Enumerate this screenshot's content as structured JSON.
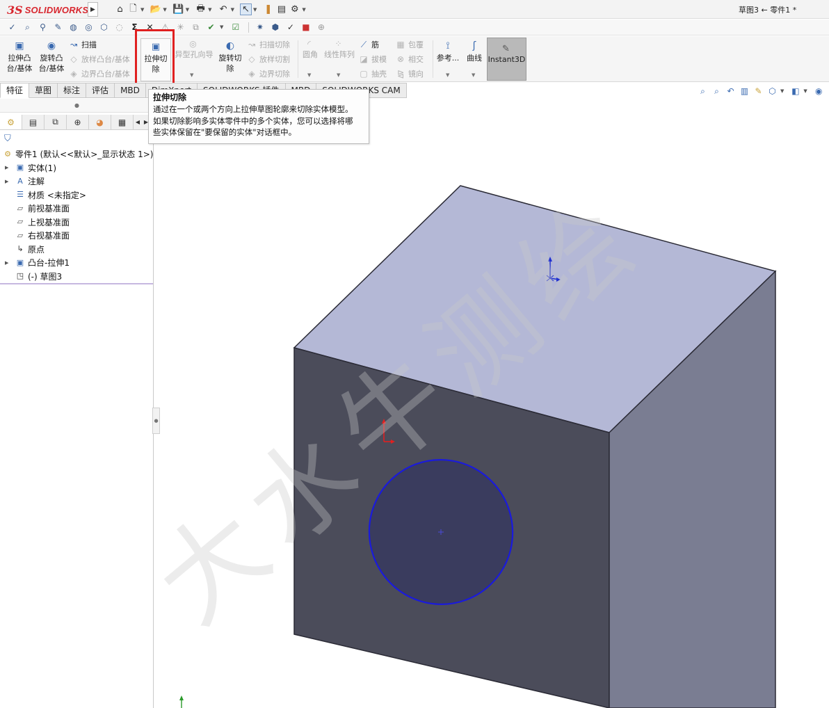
{
  "window": {
    "brand_ds": "3S",
    "brand_name": "SOLIDWORKS",
    "doc_title": "草图3 ← 零件1 *"
  },
  "quick_access": {
    "icons": [
      "home-icon",
      "new-doc-icon",
      "open-icon",
      "save-icon",
      "print-icon",
      "undo-icon",
      "select-pointer-icon",
      "rebuild-icon",
      "file-properties-icon",
      "options-gear-icon"
    ]
  },
  "ribbon": {
    "extrude_boss": "拉伸凸台/基体",
    "revolve_boss": "旋转凸台/基体",
    "sweep": "扫描",
    "loft_boss": "放样凸台/基体",
    "boundary_boss": "边界凸台/基体",
    "extrude_cut": "拉伸切除",
    "hole_wizard": "异型孔向导",
    "revolve_cut": "旋转切除",
    "swept_cut": "扫描切除",
    "lofted_cut": "放样切割",
    "boundary_cut": "边界切除",
    "fillet": "圆角",
    "linear_pattern": "线性阵列",
    "rib": "筋",
    "draft": "拔模",
    "shell": "抽壳",
    "wrap": "包覆",
    "intersect": "相交",
    "mirror": "镜向",
    "reference": "参考...",
    "curves": "曲线",
    "instant3d": "Instant3D"
  },
  "tabs": [
    "特征",
    "草图",
    "标注",
    "评估",
    "MBD",
    "DimXpert",
    "SOLIDWORKS 插件",
    "MBD",
    "SOLIDWORKS CAM"
  ],
  "tooltip": {
    "title": "拉伸切除",
    "line1": "通过在一个或两个方向上拉伸草图轮廓来切除实体模型。",
    "line2": "如果切除影响多实体零件中的多个实体，您可以选择将哪",
    "line3": "些实体保留在\"要保留的实体\"对话框中。"
  },
  "feature_tree": {
    "root": "零件1 (默认<<默认>_显示状态 1>)",
    "items": [
      {
        "label": "实体(1)"
      },
      {
        "label": "注解"
      },
      {
        "label": "材质 <未指定>"
      },
      {
        "label": "前视基准面"
      },
      {
        "label": "上视基准面"
      },
      {
        "label": "右视基准面"
      },
      {
        "label": "原点"
      },
      {
        "label": "凸台-拉伸1"
      },
      {
        "label": "(-) 草图3"
      }
    ]
  },
  "colors": {
    "brand_red": "#d8262e",
    "highlight_red": "#e02020",
    "cube_top": "#b4b8d6",
    "cube_front": "#4b4c5a",
    "cube_right": "#7a7d92",
    "sketch_circle": "#1a1adc",
    "instant3d_active": "#b9b9b9"
  },
  "watermark": "大水牛测绘"
}
